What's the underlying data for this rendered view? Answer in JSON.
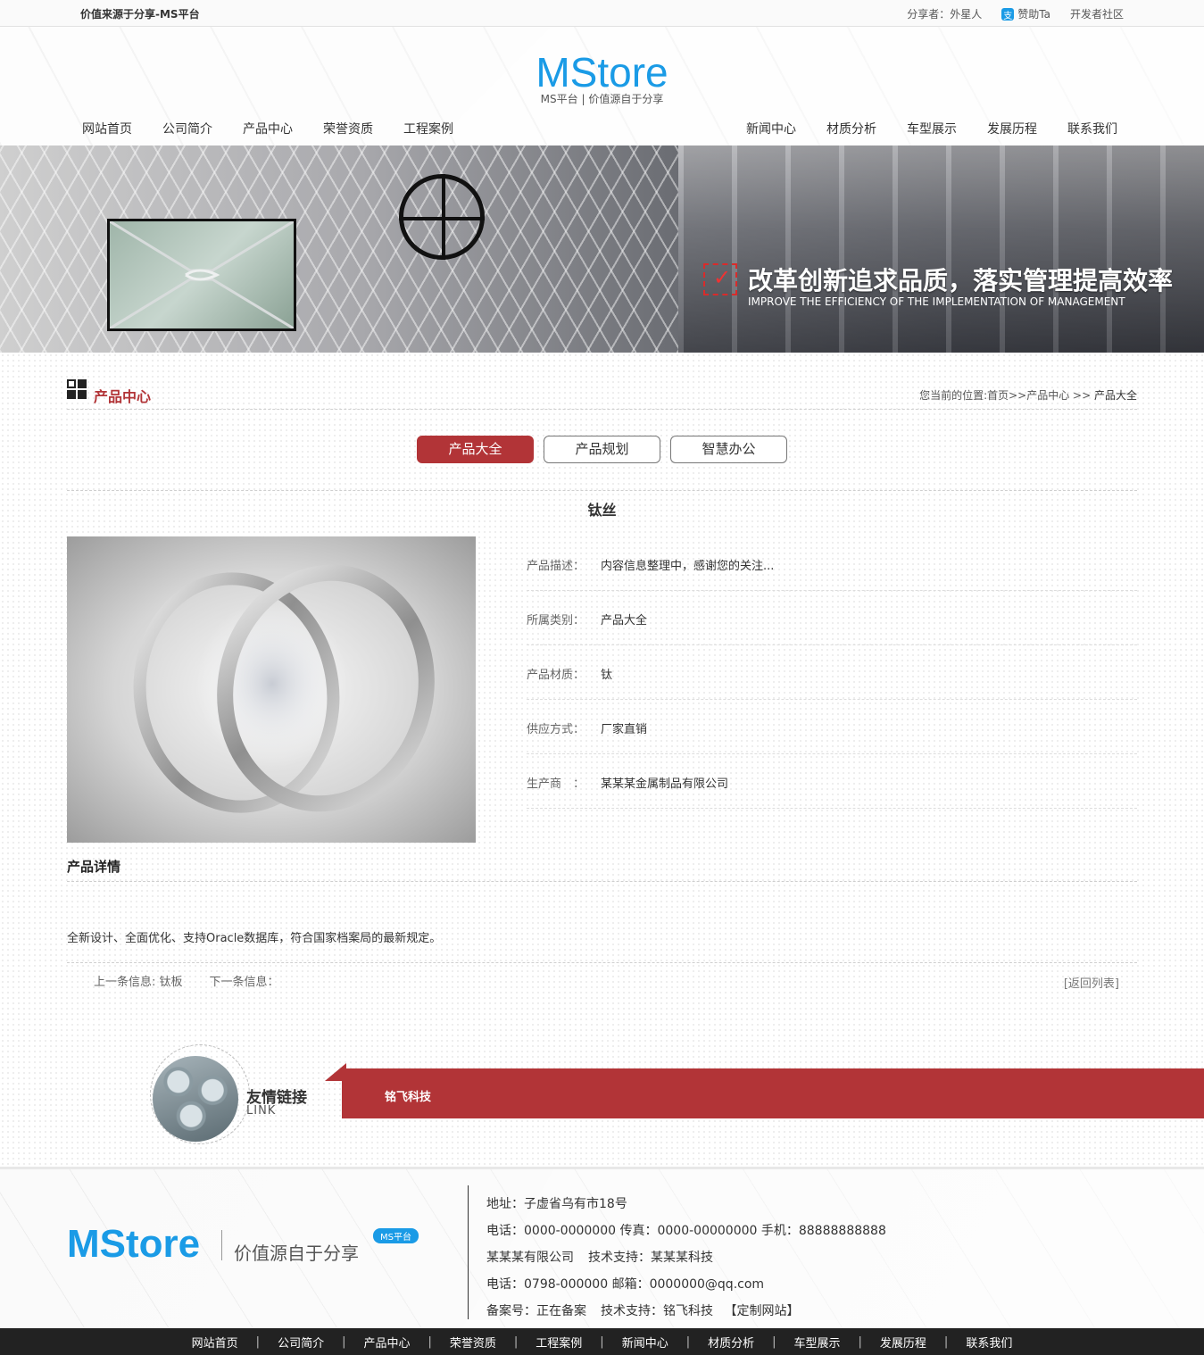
{
  "topbar": {
    "tagline": "价值来源于分享-MS平台",
    "sharer": "分享者：外星人",
    "sponsor": "赞助Ta",
    "community": "开发者社区"
  },
  "header": {
    "logo": "MStore",
    "logo_sub": "MS平台 | 价值源自于分享",
    "nav_left": [
      "网站首页",
      "公司简介",
      "产品中心",
      "荣誉资质",
      "工程案例"
    ],
    "nav_right": [
      "新闻中心",
      "材质分析",
      "车型展示",
      "发展历程",
      "联系我们"
    ]
  },
  "banner": {
    "slogan": "改革创新追求品质，落实管理提高效率",
    "slogan_en": "IMPROVE THE EFFICIENCY OF THE IMPLEMENTATION OF MANAGEMENT"
  },
  "section": {
    "title": "产品中心",
    "breadcrumb_prefix": "您当前的位置:首页>>产品中心 >> ",
    "breadcrumb_current": "产品大全"
  },
  "tabs": [
    {
      "label": "产品大全",
      "active": true
    },
    {
      "label": "产品规划",
      "active": false
    },
    {
      "label": "智慧办公",
      "active": false
    }
  ],
  "product": {
    "title": "钛丝",
    "specs": [
      {
        "key": "产品描述：",
        "value": "内容信息整理中，感谢您的关注..."
      },
      {
        "key": "所属类别：",
        "value": "产品大全"
      },
      {
        "key": "产品材质：",
        "value": "钛"
      },
      {
        "key": "供应方式：",
        "value": "厂家直销"
      },
      {
        "key": "生产商　：",
        "value": "某某某金属制品有限公司"
      }
    ],
    "detail_title": "产品详情",
    "detail_text": "全新设计、全面优化、支持Oracle数据库，符合国家档案局的最新规定。",
    "prev": "上一条信息: 钛板",
    "next": "下一条信息：",
    "back": "[返回列表]"
  },
  "friend_links": {
    "title": "友情链接",
    "subtitle": "LINK",
    "links": [
      "铭飞科技"
    ]
  },
  "footer": {
    "logo": "MStore",
    "slogan": "价值源自于分享",
    "badge": "MS平台",
    "address": "地址：子虚省乌有市18号",
    "phones": "电话：0000-0000000 传真：0000-00000000 手机：88888888888",
    "company": "某某某有限公司",
    "support": "技术支持：某某某科技",
    "contact": "电话：0798-000000 邮箱：0000000@qq.com",
    "icp": "备案号：正在备案",
    "support2": "技术支持：铭飞科技",
    "custom": "【定制网站】"
  },
  "bottom_nav": [
    "网站首页",
    "公司简介",
    "产品中心",
    "荣誉资质",
    "工程案例",
    "新闻中心",
    "材质分析",
    "车型展示",
    "发展历程",
    "联系我们"
  ],
  "colors": {
    "brand_blue": "#1a9be6",
    "accent_red": "#b23437",
    "footer_bar": "#222222"
  }
}
